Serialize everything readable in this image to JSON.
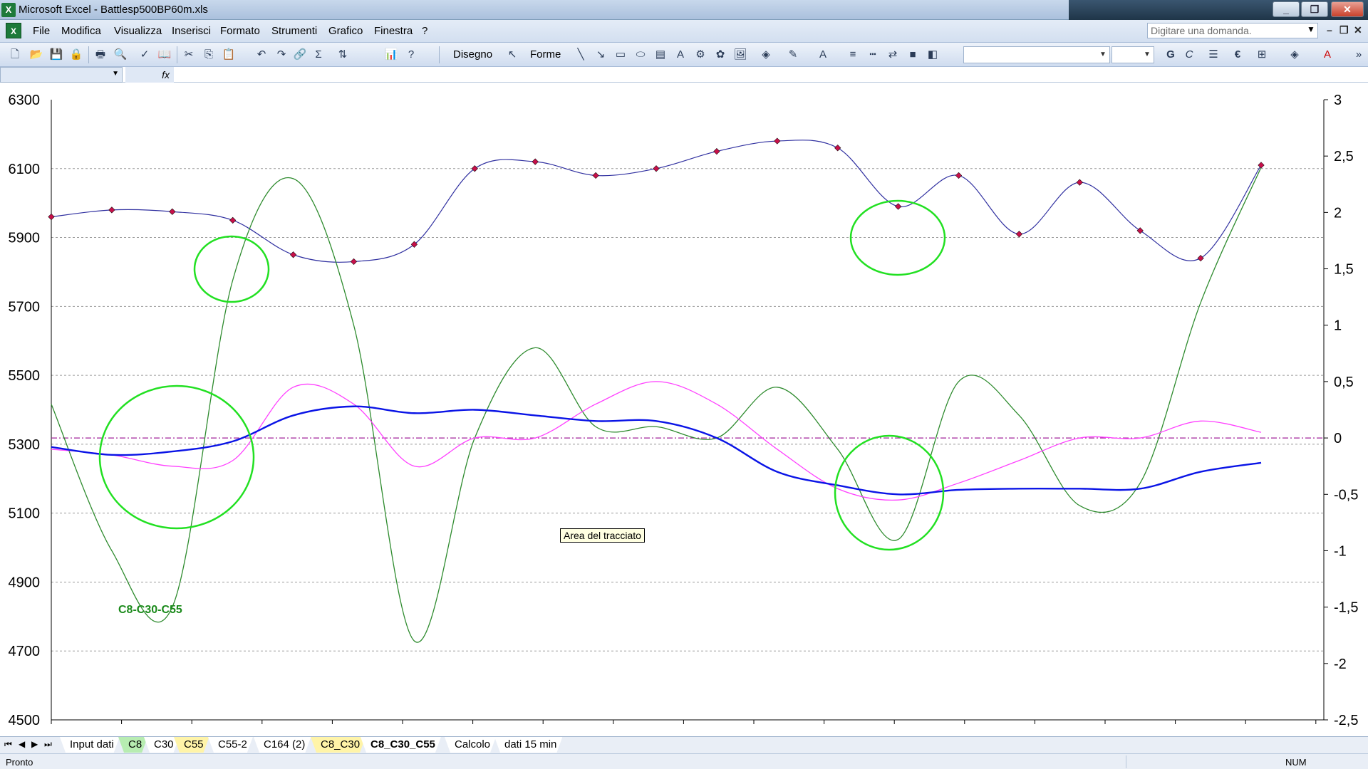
{
  "window": {
    "title": "Microsoft Excel - Battlesp500BP60m.xls",
    "buttons": [
      "_",
      "❐",
      "✕"
    ]
  },
  "menubar": {
    "items": [
      "File",
      "Modifica",
      "Visualizza",
      "Inserisci",
      "Formato",
      "Strumenti",
      "Grafico",
      "Finestra",
      "?"
    ],
    "ask_placeholder": "Digitare una domanda."
  },
  "toolbar": {
    "draw_label": "Disegno",
    "shapes_label": "Forme",
    "bold": "G",
    "italic": "C",
    "euro": "€",
    "sigma": "Σ"
  },
  "formula": {
    "fx": "fx"
  },
  "chart": {
    "tooltip": "Area del tracciato",
    "series_label": "C8-C30-C55",
    "colors": {
      "price_line": "#3030a0",
      "price_marker": "#c8104a",
      "blue": "#0a14e6",
      "magenta": "#ff40ff",
      "green": "#2e8b2e",
      "circle": "#22e022",
      "zero_line": "#a0209a"
    }
  },
  "chart_data": {
    "type": "line",
    "left_axis": {
      "ticks": [
        "6300",
        "6100",
        "5900",
        "5700",
        "5500",
        "5300",
        "5100",
        "4900",
        "4700",
        "4500"
      ],
      "ylim": [
        4500,
        6300
      ]
    },
    "right_axis": {
      "ticks": [
        "3",
        "2,5",
        "2",
        "1,5",
        "1",
        "0,5",
        "0",
        "-0,5",
        "-1",
        "-1,5",
        "-2",
        "-2,5"
      ],
      "ylim": [
        -2.5,
        3
      ]
    },
    "x": [
      0,
      5,
      10,
      15,
      20,
      25,
      30,
      35,
      40,
      45,
      50,
      55,
      60,
      65,
      70,
      75,
      80,
      85,
      90,
      95,
      100
    ],
    "series": [
      {
        "axis": "left",
        "values": [
          5960,
          5980,
          5975,
          5950,
          5850,
          5830,
          5880,
          6100,
          6120,
          6080,
          6100,
          6150,
          6180,
          6160,
          5990,
          6080,
          5910,
          6060,
          5920,
          5840,
          6110
        ]
      },
      {
        "axis": "right",
        "values": [
          0.3,
          -1.0,
          -1.5,
          1.4,
          2.3,
          1.0,
          -1.8,
          0.0,
          0.8,
          0.1,
          0.1,
          0.0,
          0.45,
          -0.1,
          -0.9,
          0.5,
          0.2,
          -0.6,
          -0.4,
          1.2,
          2.4
        ]
      },
      {
        "axis": "right",
        "values": [
          -0.1,
          -0.15,
          -0.25,
          -0.2,
          0.45,
          0.3,
          -0.25,
          0.0,
          0.0,
          0.3,
          0.5,
          0.3,
          -0.1,
          -0.45,
          -0.55,
          -0.4,
          -0.2,
          0.0,
          0.0,
          0.15,
          0.05
        ]
      },
      {
        "axis": "right",
        "values": [
          -0.08,
          -0.15,
          -0.12,
          -0.03,
          0.2,
          0.28,
          0.22,
          0.25,
          0.2,
          0.15,
          0.15,
          0.0,
          -0.3,
          -0.42,
          -0.5,
          -0.46,
          -0.45,
          -0.45,
          -0.45,
          -0.3,
          -0.22
        ]
      }
    ]
  },
  "sheets": {
    "tabs": [
      "Input dati",
      "C8",
      "C30",
      "C55",
      "C55-2",
      "C164 (2)",
      "C8_C30",
      "C8_C30_C55",
      "Calcolo",
      "dati 15 min"
    ]
  },
  "statusbar": {
    "ready": "Pronto",
    "num": "NUM"
  }
}
